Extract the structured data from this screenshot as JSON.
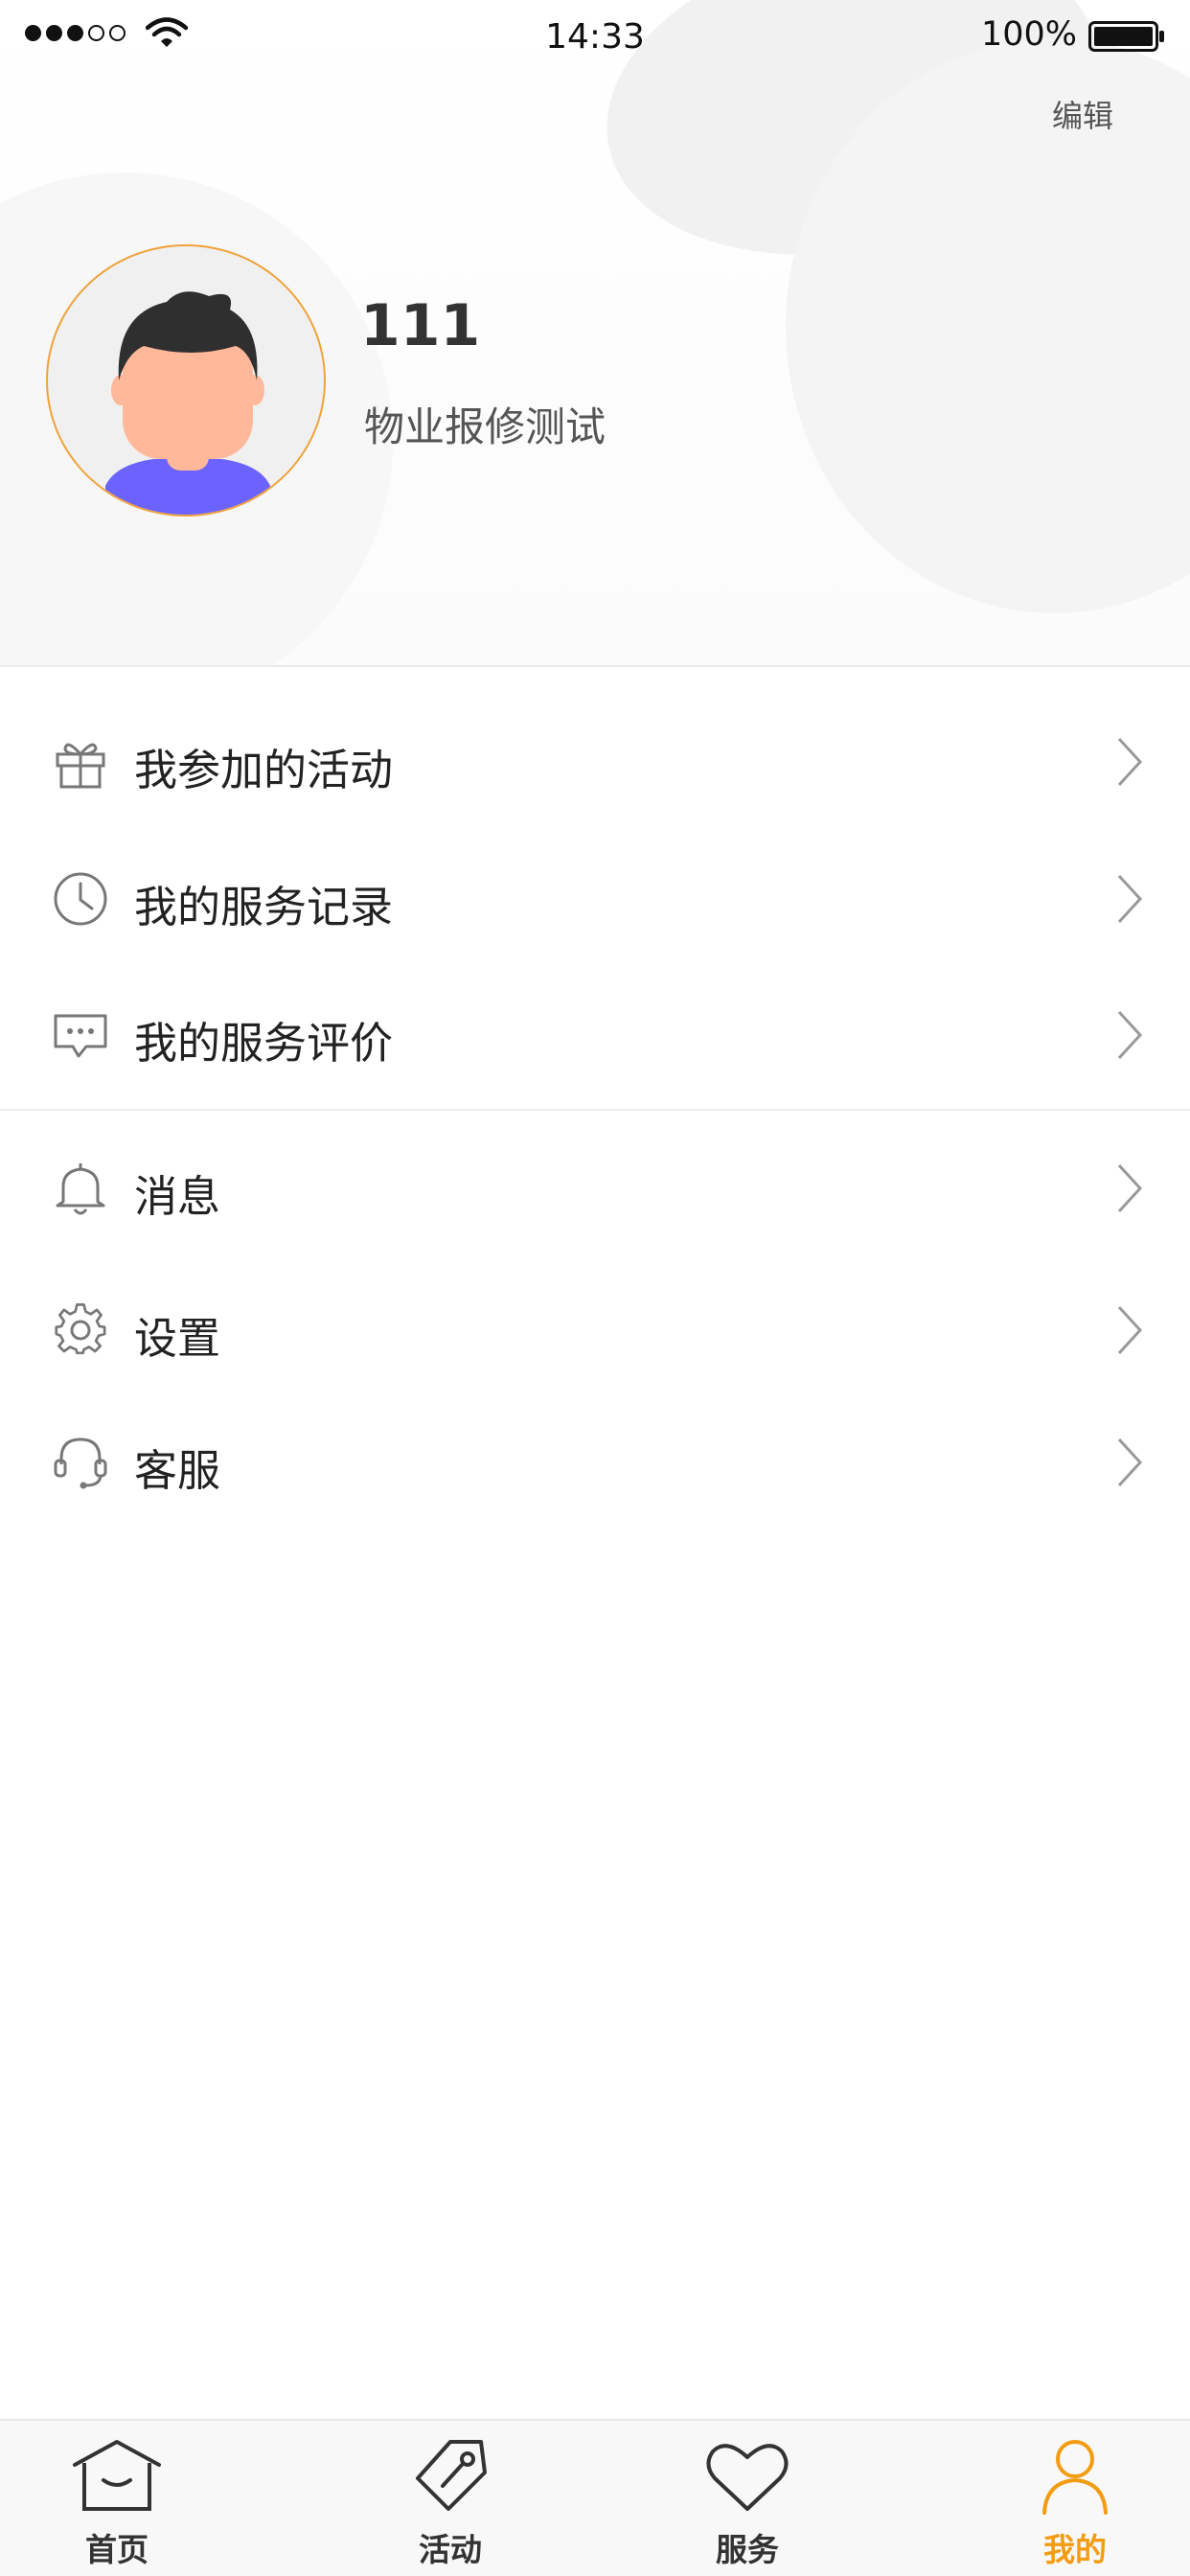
{
  "status_bar": {
    "time": "14:33",
    "battery_percent": "100%",
    "signal_bars_filled": 3,
    "signal_bars_total": 5
  },
  "profile": {
    "edit_label": "编辑",
    "username": "111",
    "subtitle": "物业报修测试",
    "avatar_ring_color": "#f0a33a"
  },
  "menu": {
    "group1": [
      {
        "label": "我参加的活动",
        "icon": "gift-icon"
      },
      {
        "label": "我的服务记录",
        "icon": "clock-icon"
      },
      {
        "label": "我的服务评价",
        "icon": "chat-bubble-icon"
      }
    ],
    "group2": [
      {
        "label": "消息",
        "icon": "bell-icon"
      },
      {
        "label": "设置",
        "icon": "gear-icon"
      },
      {
        "label": "客服",
        "icon": "headset-icon"
      }
    ]
  },
  "tab_bar": {
    "tabs": [
      {
        "label": "首页",
        "icon": "home-icon"
      },
      {
        "label": "活动",
        "icon": "tag-icon"
      },
      {
        "label": "服务",
        "icon": "heart-icon"
      },
      {
        "label": "我的",
        "icon": "user-icon"
      }
    ],
    "active_index": 3,
    "active_color": "#f39c12"
  }
}
